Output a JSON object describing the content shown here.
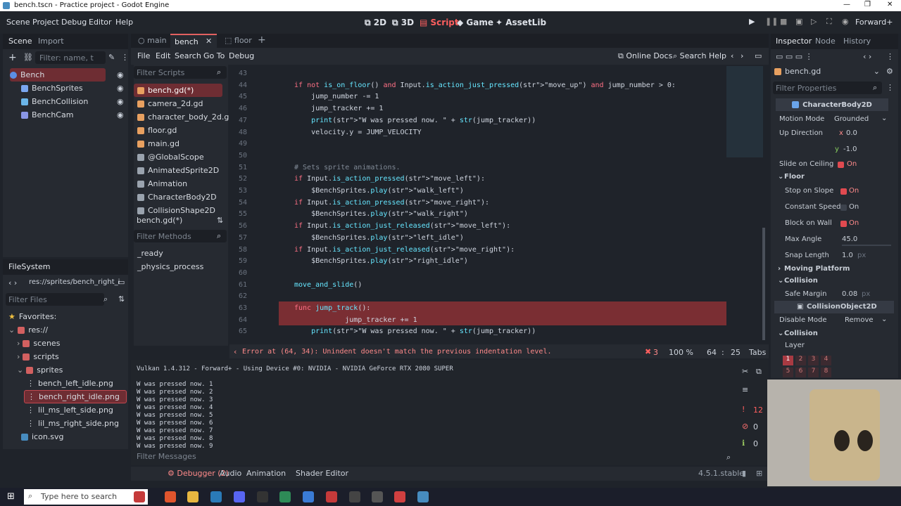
{
  "window": {
    "title": "bench.tscn - Practice project - Godot Engine"
  },
  "menu": [
    "Scene",
    "Project",
    "Debug",
    "Editor",
    "Help"
  ],
  "workspaces": [
    "2D",
    "3D",
    "Script",
    "Game",
    "AssetLib"
  ],
  "renderer": "Forward+",
  "scene_panel": {
    "tabs": [
      "Scene",
      "Import"
    ],
    "filter_placeholder": "Filter: name, t",
    "nodes": [
      "Bench",
      "BenchSprites",
      "BenchCollision",
      "BenchCam"
    ]
  },
  "filesystem": {
    "title": "FileSystem",
    "path": "res://sprites/bench_right_i",
    "filter_placeholder": "Filter Files",
    "items": [
      "Favorites:",
      "res://",
      "scenes",
      "scripts",
      "sprites",
      "bench_left_idle.png",
      "bench_right_idle.png",
      "lil_ms_left_side.png",
      "lil_ms_right_side.png",
      "icon.svg"
    ]
  },
  "editor_tabs": [
    "main",
    "bench",
    "floor"
  ],
  "script_menu": [
    "File",
    "Edit",
    "Search",
    "Go To",
    "Debug"
  ],
  "script_tools": {
    "docs": "Online Docs",
    "help": "Search Help"
  },
  "scripts_panel": {
    "filter_placeholder": "Filter Scripts",
    "items": [
      "bench.gd(*)",
      "camera_2d.gd",
      "character_body_2d.gd",
      "floor.gd",
      "main.gd",
      "@GlobalScope",
      "AnimatedSprite2D",
      "Animation",
      "CharacterBody2D",
      "CollisionShape2D"
    ],
    "current": "bench.gd(*)",
    "methods_placeholder": "Filter Methods",
    "methods": [
      "_ready",
      "_physics_process"
    ]
  },
  "code": [
    {
      "n": "43",
      "t": ""
    },
    {
      "n": "44",
      "t": "if not is_on_floor() and Input.is_action_just_pressed(\"move_up\") and jump_number > 0:"
    },
    {
      "n": "45",
      "t": "    jump_number -= 1"
    },
    {
      "n": "46",
      "t": "    jump_tracker += 1"
    },
    {
      "n": "47",
      "t": "    print(\"W was pressed now. \" + str(jump_tracker))"
    },
    {
      "n": "48",
      "t": "    velocity.y = JUMP_VELOCITY"
    },
    {
      "n": "49",
      "t": ""
    },
    {
      "n": "50",
      "t": ""
    },
    {
      "n": "51",
      "t": "# Sets sprite animations."
    },
    {
      "n": "52",
      "t": "if Input.is_action_pressed(\"move_left\"):"
    },
    {
      "n": "53",
      "t": "    $BenchSprites.play(\"walk_left\")"
    },
    {
      "n": "54",
      "t": "if Input.is_action_pressed(\"move_right\"):"
    },
    {
      "n": "55",
      "t": "    $BenchSprites.play(\"walk_right\")"
    },
    {
      "n": "56",
      "t": "if Input.is_action_just_released(\"move_left\"):"
    },
    {
      "n": "57",
      "t": "    $BenchSprites.play(\"left_idle\")"
    },
    {
      "n": "58",
      "t": "if Input.is_action_just_released(\"move_right\"):"
    },
    {
      "n": "59",
      "t": "    $BenchSprites.play(\"right_idle\")"
    },
    {
      "n": "60",
      "t": ""
    },
    {
      "n": "61",
      "t": "move_and_slide()"
    },
    {
      "n": "62",
      "t": ""
    },
    {
      "n": "63",
      "t": "func jump_track():"
    },
    {
      "n": "64",
      "t": "            jump_tracker += 1"
    },
    {
      "n": "65",
      "t": "    print(\"W was pressed now. \" + str(jump_tracker))"
    }
  ],
  "status": {
    "error": "Error at (64, 34): Unindent doesn't match the previous indentation level.",
    "errors": "3",
    "zoom": "100 %",
    "line": "64",
    "col": "25",
    "indent": "Tabs"
  },
  "output": {
    "header": "Vulkan 1.4.312 - Forward+ - Using Device #0: NVIDIA - NVIDIA GeForce RTX 2080 SUPER",
    "lines": [
      "W was pressed now. 1",
      "W was pressed now. 2",
      "W was pressed now. 3",
      "W was pressed now. 4",
      "W was pressed now. 5",
      "W was pressed now. 6",
      "W was pressed now. 7",
      "W was pressed now. 8",
      "W was pressed now. 9"
    ],
    "filter_placeholder": "Filter Messages",
    "counts": [
      "12",
      "0",
      "0"
    ]
  },
  "bottom_tabs": [
    "Debugger (2)",
    "Audio",
    "Animation",
    "Shader Editor"
  ],
  "version": "4.5.1.stable",
  "inspector": {
    "tabs": [
      "Inspector",
      "Node",
      "History"
    ],
    "resource": "bench.gd",
    "filter_placeholder": "Filter Properties",
    "class": "CharacterBody2D",
    "motion_mode": "Grounded",
    "up_x": "0.0",
    "up_y": "-1.0",
    "slide_on_ceiling": "On",
    "floor": "Floor",
    "stop_on_slope": "On",
    "constant_speed": "On",
    "block_on_wall": "On",
    "max_angle": "45.0",
    "snap_length": "1.0",
    "px": "px",
    "moving_platform": "Moving Platform",
    "collision": "Collision",
    "safe_margin": "0.08",
    "collision_class": "CollisionObject2D",
    "disable_mode": "Remove",
    "layer": "Layer",
    "layers": [
      "1",
      "2",
      "3",
      "4",
      "5",
      "6",
      "7",
      "8"
    ],
    "labels": {
      "motion": "Motion Mode",
      "up": "Up Direction",
      "slide": "Slide on Ceiling",
      "stop": "Stop on Slope",
      "const": "Constant Speed",
      "block": "Block on Wall",
      "angle": "Max Angle",
      "snap": "Snap Length",
      "margin": "Safe Margin",
      "disable": "Disable Mode"
    }
  },
  "taskbar": {
    "search": "Type here to search"
  }
}
